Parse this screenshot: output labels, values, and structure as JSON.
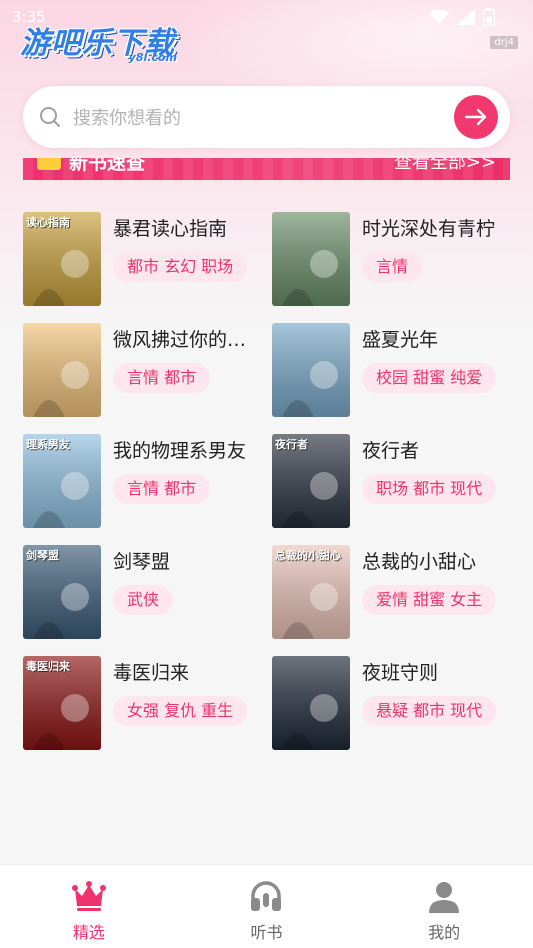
{
  "status_bar": {
    "time": "3:35"
  },
  "header": {
    "logo_text": "游吧乐下载",
    "logo_sub": "y8l.com",
    "watermark": "drj4"
  },
  "search": {
    "placeholder": "搜索你想看的"
  },
  "section": {
    "title": "新书速查",
    "more_label": "查看全部>>"
  },
  "books": [
    {
      "title": "暴君读心指南",
      "tags": "都市 玄幻 职场",
      "cover_text": "读心指南",
      "cover_color": "#c9a23c"
    },
    {
      "title": "时光深处有青柠",
      "tags": "言情",
      "cover_text": "",
      "cover_color": "#6a8f6a"
    },
    {
      "title": "微风拂过你的…",
      "tags": "言情 都市",
      "cover_text": "",
      "cover_color": "#f1c27a"
    },
    {
      "title": "盛夏光年",
      "tags": "校园 甜蜜 纯爱",
      "cover_text": "",
      "cover_color": "#7aa9c9"
    },
    {
      "title": "我的物理系男友",
      "tags": "言情 都市",
      "cover_text": "理系男友",
      "cover_color": "#8fc0e0"
    },
    {
      "title": "夜行者",
      "tags": "职场 都市 现代",
      "cover_text": "夜行者",
      "cover_color": "#2d3542"
    },
    {
      "title": "剑琴盟",
      "tags": "武侠",
      "cover_text": "剑琴盟",
      "cover_color": "#3d5d7a"
    },
    {
      "title": "总裁的小甜心",
      "tags": "爱情 甜蜜 女主",
      "cover_text": "总裁的小甜心",
      "cover_color": "#e9c3b8"
    },
    {
      "title": "毒医归来",
      "tags": "女强 复仇 重生",
      "cover_text": "毒医归来",
      "cover_color": "#8e1515"
    },
    {
      "title": "夜班守则",
      "tags": "悬疑 都市 现代",
      "cover_text": "",
      "cover_color": "#1f2a3a"
    }
  ],
  "tabbar": {
    "items": [
      {
        "label": "精选",
        "icon": "crown-icon",
        "active": true
      },
      {
        "label": "听书",
        "icon": "headphones-icon",
        "active": false
      },
      {
        "label": "我的",
        "icon": "user-icon",
        "active": false
      }
    ]
  },
  "colors": {
    "accent": "#f0336c",
    "tag_bg": "#fde6ee"
  }
}
